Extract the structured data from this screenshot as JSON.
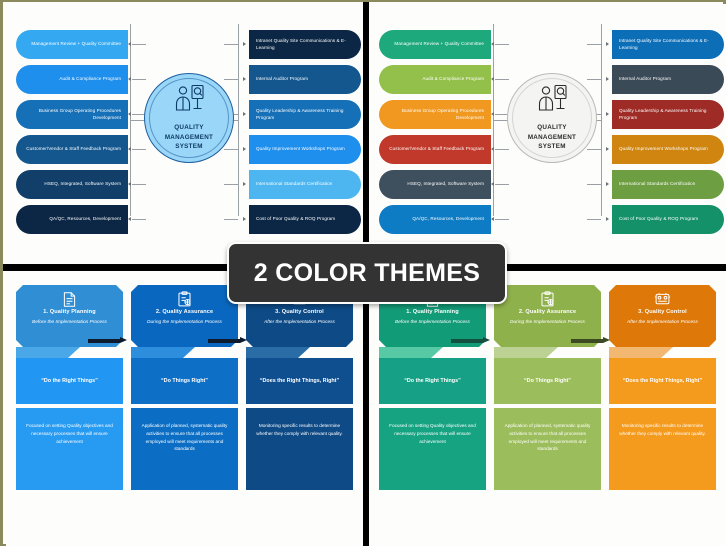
{
  "banner": {
    "text": "2 COLOR THEMES"
  },
  "qms": {
    "center": {
      "title_line1": "QUALITY",
      "title_line2": "MANAGEMENT",
      "title_line3": "SYSTEM",
      "icon": "quality-inspector-icon"
    },
    "left_items": [
      {
        "label": "Management Review + Quality Committee",
        "blue": "#34a9f2",
        "color": "#1ea97c"
      },
      {
        "label": "Audit & Compliance Program",
        "blue": "#1f8fee",
        "color": "#93c04a"
      },
      {
        "label": "Business Group Operating Procedures Development",
        "blue": "#1570b8",
        "color": "#f0981f"
      },
      {
        "label": "Customer/Vendor & Staff Feedback Program",
        "blue": "#14578f",
        "color": "#c0392b"
      },
      {
        "label": "HSEQ, Integrated, Software System",
        "blue": "#113f69",
        "color": "#3e4f5e"
      },
      {
        "label": "QA/QC, Resources, Development",
        "blue": "#0c2745",
        "color": "#0d7cc4"
      }
    ],
    "right_items": [
      {
        "label": "Intranet Quality Site Communications & E-Learning",
        "blue": "#0c2745",
        "color": "#0d6eb8"
      },
      {
        "label": "Internal Auditor Program",
        "blue": "#14578f",
        "color": "#3b4a57"
      },
      {
        "label": "Quality Leadership & Awareness Training Program",
        "blue": "#1570b8",
        "color": "#9e2b25"
      },
      {
        "label": "Quality Improvement Workshops Program",
        "blue": "#1f8fee",
        "color": "#cf8510"
      },
      {
        "label": "International Standards Certification",
        "blue": "#4db6f0",
        "color": "#6d9e42"
      },
      {
        "label": "Cost of Poor Quality & ROQ Program",
        "blue": "#0c2745",
        "color": "#159169"
      }
    ],
    "circle_blue_fill": "#9ad6f8",
    "circle_blue_stroke": "#1d5f9e",
    "circle_color_fill": "#f4f4f2",
    "circle_color_stroke": "#b9b9b4"
  },
  "process": {
    "steps": [
      {
        "title": "1. Quality Planning",
        "subtitle": "Before the Implementation Process",
        "quote": "“Do the Right Things”",
        "body": "Focused on setting Quality objectives and necessary processes that will ensure achievement",
        "icon": "document-checklist-icon",
        "blue": {
          "head": "#2f8ed4",
          "ribbon": "#4aa8e8",
          "quote": "#2196f3",
          "body": "#279af1"
        },
        "color": {
          "head": "#129b77",
          "ribbon": "#57c9a4",
          "quote": "#16a085",
          "body": "#15a381"
        }
      },
      {
        "title": "2. Quality Assurance",
        "subtitle": "During the Implementation Process",
        "quote": "“Do Things Right”",
        "body": "Application of planned, systematic quality activities to ensure that all processes employed will meet requirements and standards",
        "icon": "clipboard-gear-icon",
        "blue": {
          "head": "#0a67bf",
          "ribbon": "#2e8ede",
          "quote": "#0d6fc6",
          "body": "#0b6ec4"
        },
        "color": {
          "head": "#8fb14b",
          "ribbon": "#bcd294",
          "quote": "#9cbd5b",
          "body": "#9cbd5b"
        }
      },
      {
        "title": "3. Quality Control",
        "subtitle": "After the Implementation Process",
        "quote": "“Does the Right Things, Right”",
        "body": "Monitoring specific results to determine whether they comply with relevant quality.",
        "icon": "quality-control-badge-icon",
        "blue": {
          "head": "#0d4a86",
          "ribbon": "#2a6ca6",
          "quote": "#0f4f8f",
          "body": "#0e4a86"
        },
        "color": {
          "head": "#dd7809",
          "ribbon": "#f2b872",
          "quote": "#f49a1c",
          "body": "#f49a1c"
        }
      }
    ],
    "arrow_blue": "#0c1c2e",
    "arrow_color_left": "#14503f",
    "arrow_color_right": "#3b4a22"
  }
}
